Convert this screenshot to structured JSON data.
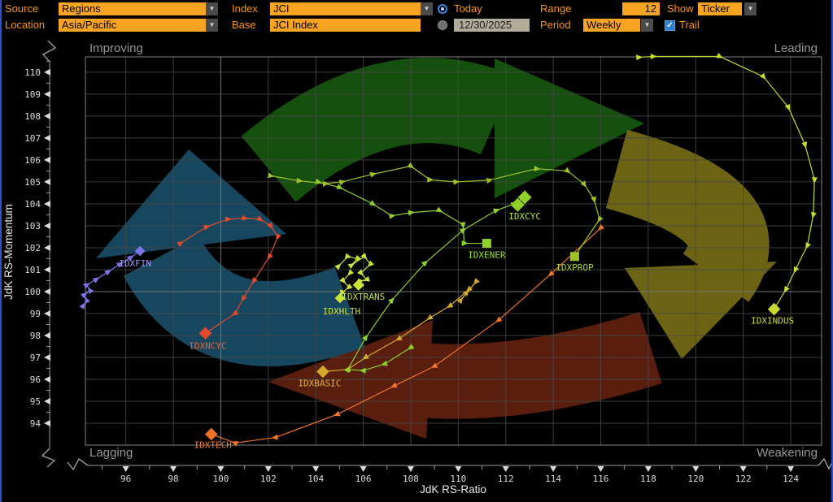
{
  "toolbar": {
    "source": {
      "label": "Source",
      "value": "Regions"
    },
    "location": {
      "label": "Location",
      "value": "Asia/Pacific"
    },
    "index": {
      "label": "Index",
      "value": "JCI"
    },
    "base": {
      "label": "Base",
      "value": "JCI Index"
    },
    "today": {
      "label": "Today",
      "selected": true
    },
    "date": {
      "value": "12/30/2025",
      "selected": false
    },
    "range": {
      "label": "Range",
      "value": "12"
    },
    "period": {
      "label": "Period",
      "value": "Weekly"
    },
    "show": {
      "label": "Show",
      "value": "Ticker"
    },
    "trail": {
      "label": "Trail",
      "checked": true,
      "checkmark": "✓"
    },
    "dropdown_glyph": "▼"
  },
  "chart": {
    "quadrant_labels": {
      "top_left": "Improving",
      "top_right": "Leading",
      "bottom_left": "Lagging",
      "bottom_right": "Weakening"
    },
    "grid_color": "#464646",
    "center_line_color": "#7d7d7d",
    "border_color": "#9a9a9a",
    "tick_label_color": "#dcdcdc",
    "quadrant_label_color": "#969696",
    "axis_title_color": "#e8e8e8",
    "rotation_arrows": {
      "top": "#15500e",
      "right": "#6c6414",
      "bottom": "#5a1e0e",
      "left": "#17465f"
    }
  },
  "chart_data": {
    "type": "scatter",
    "title": "Relative Rotation Graph (RRG) - JCI sectors",
    "xlabel": "JdK RS-Ratio",
    "ylabel": "JdK RS-Momentum",
    "xlim": [
      94.3,
      125.3
    ],
    "ylim": [
      93.0,
      110.7
    ],
    "x_ticks": [
      96,
      98,
      100,
      102,
      104,
      106,
      108,
      110,
      112,
      114,
      116,
      118,
      120,
      122,
      124
    ],
    "y_ticks": [
      94,
      95,
      96,
      97,
      98,
      99,
      100,
      101,
      102,
      103,
      104,
      105,
      106,
      107,
      108,
      109,
      110
    ],
    "legend_position": "none",
    "grid": true,
    "series": [
      {
        "ticker": "IDXFIN",
        "color": "#7d74e8",
        "label_color": "#9d97f2",
        "marker": "diamond",
        "msize": 9,
        "marker_xy": [
          96.6,
          101.85
        ],
        "label_dx": -6,
        "label_dy": 14,
        "trail": [
          [
            94.2,
            99.35
          ],
          [
            94.35,
            99.6
          ],
          [
            94.25,
            99.85
          ],
          [
            94.5,
            100.05
          ],
          [
            94.35,
            100.3
          ],
          [
            94.75,
            100.55
          ],
          [
            95.25,
            100.9
          ],
          [
            95.75,
            101.25
          ],
          [
            96.2,
            101.55
          ]
        ]
      },
      {
        "ticker": "IDXNCYC",
        "color": "#e14a2d",
        "label_color": "#ef5c34",
        "marker": "diamond",
        "msize": 11,
        "marker_xy": [
          99.35,
          98.1
        ],
        "label_dx": 3,
        "label_dy": 14,
        "trail": [
          [
            98.3,
            102.2
          ],
          [
            99.4,
            102.95
          ],
          [
            100.3,
            103.3
          ],
          [
            101.0,
            103.35
          ],
          [
            101.65,
            103.3
          ],
          [
            102.1,
            103.0
          ],
          [
            102.4,
            102.5
          ],
          [
            102.05,
            101.6
          ],
          [
            101.4,
            100.5
          ],
          [
            100.95,
            99.7
          ],
          [
            100.6,
            99.0
          ]
        ]
      },
      {
        "ticker": "IDXTECH",
        "color": "#ee7425",
        "label_color": "#f07d28",
        "marker": "diamond",
        "msize": 11,
        "marker_xy": [
          99.6,
          93.5
        ],
        "label_dx": 2,
        "label_dy": 12,
        "trail": [
          [
            116.0,
            102.9
          ],
          [
            113.9,
            100.8
          ],
          [
            111.7,
            98.7
          ],
          [
            109.0,
            96.6
          ],
          [
            107.3,
            95.7
          ],
          [
            104.9,
            94.4
          ],
          [
            102.3,
            93.35
          ],
          [
            100.6,
            93.1
          ]
        ]
      },
      {
        "ticker": "IDXBASIC",
        "color": "#d2a92c",
        "label_color": "#d8b234",
        "marker": "diamond",
        "msize": 11,
        "marker_xy": [
          104.3,
          96.35
        ],
        "label_dx": -4,
        "label_dy": 13,
        "trail": [
          [
            110.35,
            99.95
          ],
          [
            110.75,
            100.45
          ],
          [
            110.1,
            99.6
          ],
          [
            110.45,
            100.1
          ],
          [
            109.65,
            99.35
          ],
          [
            108.8,
            98.8
          ],
          [
            107.5,
            97.85
          ],
          [
            106.1,
            97.0
          ],
          [
            105.35,
            96.45
          ]
        ]
      },
      {
        "ticker": "IDXHLTH",
        "color": "#cbe23a",
        "label_color": "#cbe23a",
        "marker": "diamond",
        "msize": 9,
        "marker_xy": [
          105.02,
          99.7
        ],
        "label_dx": 2,
        "label_dy": 15,
        "trail": [
          [
            105.45,
            100.85
          ],
          [
            105.15,
            100.5
          ],
          [
            105.4,
            100.2
          ],
          [
            105.1,
            99.95
          ]
        ]
      },
      {
        "ticker": "IDXTRANS",
        "color": "#cbe23a",
        "label_color": "#cbe23a",
        "marker": "diamond",
        "msize": 10,
        "marker_xy": [
          105.8,
          100.3
        ],
        "label_dx": 6,
        "label_dy": 13,
        "trail": [
          [
            104.95,
            101.15
          ],
          [
            105.35,
            101.6
          ],
          [
            105.75,
            101.5
          ],
          [
            105.5,
            101.2
          ],
          [
            106.05,
            101.6
          ],
          [
            106.3,
            101.25
          ],
          [
            105.9,
            100.85
          ],
          [
            106.15,
            100.55
          ],
          [
            105.85,
            100.45
          ]
        ]
      },
      {
        "ticker": "IDXENER",
        "color": "#8fd02a",
        "label_color": "#9de42e",
        "marker": "square",
        "msize": 11,
        "marker_xy": [
          111.2,
          102.2
        ],
        "label_dx": 0,
        "label_dy": 13,
        "trail": [
          [
            104.1,
            105.0
          ],
          [
            105.0,
            104.75
          ],
          [
            106.4,
            104.0
          ],
          [
            107.2,
            103.45
          ],
          [
            108.0,
            103.6
          ],
          [
            109.2,
            103.7
          ],
          [
            110.2,
            103.05
          ],
          [
            110.25,
            102.2
          ]
        ]
      },
      {
        "ticker": "IDXCYC",
        "color": "#8fd02a",
        "label_color": "#b4e83a",
        "marker": "diamond",
        "msize": 12,
        "marker_xy": [
          112.8,
          104.3
        ],
        "extra_marker": [
          112.5,
          103.95
        ],
        "label_dx": 0,
        "label_dy": 22,
        "trail": [
          [
            108.0,
            97.45
          ],
          [
            106.9,
            96.7
          ],
          [
            106.0,
            96.4
          ],
          [
            105.35,
            96.45
          ],
          [
            106.1,
            97.9
          ],
          [
            107.2,
            99.6
          ],
          [
            108.6,
            101.3
          ],
          [
            110.2,
            102.8
          ],
          [
            111.6,
            103.7
          ],
          [
            112.35,
            104.0
          ]
        ]
      },
      {
        "ticker": "IDXPROP",
        "color": "#9cc427",
        "label_color": "#aed42c",
        "marker": "square",
        "msize": 11,
        "marker_xy": [
          114.9,
          101.6
        ],
        "label_dx": 0,
        "label_dy": 12,
        "trail": [
          [
            102.1,
            105.28
          ],
          [
            103.3,
            105.05
          ],
          [
            104.4,
            104.92
          ],
          [
            105.1,
            105.0
          ],
          [
            106.4,
            105.35
          ],
          [
            108.0,
            105.72
          ],
          [
            108.8,
            105.1
          ],
          [
            109.9,
            105.0
          ],
          [
            111.3,
            105.08
          ],
          [
            113.3,
            105.6
          ],
          [
            114.6,
            105.5
          ],
          [
            115.3,
            104.9
          ],
          [
            115.72,
            104.2
          ],
          [
            115.95,
            103.3
          ]
        ]
      },
      {
        "ticker": "IDXINDUS",
        "color": "#c6d92f",
        "label_color": "#ccdc3a",
        "marker": "diamond",
        "msize": 11,
        "marker_xy": [
          123.3,
          99.2
        ],
        "label_dx": -2,
        "label_dy": 13,
        "trail": [
          [
            117.6,
            110.68
          ],
          [
            118.2,
            110.72
          ],
          [
            121.0,
            110.72
          ],
          [
            122.85,
            109.8
          ],
          [
            123.9,
            108.4
          ],
          [
            124.6,
            106.7
          ],
          [
            125.0,
            105.1
          ],
          [
            124.95,
            103.5
          ],
          [
            124.7,
            102.1
          ],
          [
            124.2,
            101.0
          ],
          [
            123.8,
            100.1
          ]
        ]
      }
    ]
  }
}
